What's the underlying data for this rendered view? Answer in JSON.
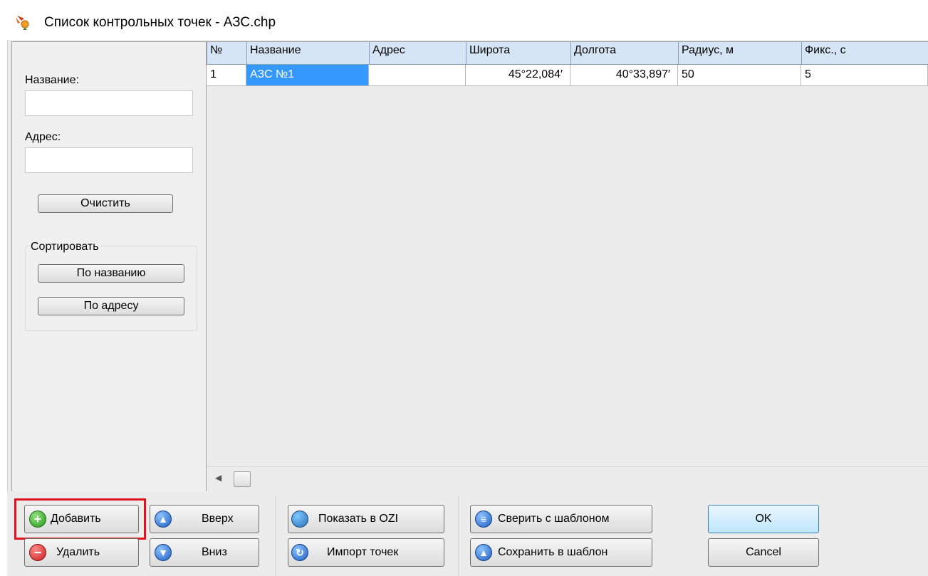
{
  "window": {
    "title": "Список контрольных точек - АЗС.chp",
    "icon": "satellite-pin-icon"
  },
  "filter": {
    "name_label": "Название:",
    "name_value": "",
    "address_label": "Адрес:",
    "address_value": "",
    "clear_label": "Очистить"
  },
  "sort": {
    "group_label": "Сортировать",
    "by_name_label": "По названию",
    "by_address_label": "По адресу"
  },
  "table": {
    "columns": [
      "№",
      "Название",
      "Адрес",
      "Широта",
      "Долгота",
      "Радиус, м",
      "Фикс., с"
    ],
    "rows": [
      [
        "1",
        "АЗС №1",
        "",
        "45°22,084′",
        "40°33,897′",
        "50",
        "5"
      ]
    ],
    "selected_row": 0,
    "selected_column": 1
  },
  "toolbar": {
    "add_label": "Добавить",
    "delete_label": "Удалить",
    "up_label": "Вверх",
    "down_label": "Вниз",
    "show_ozi_label": "Показать в OZI",
    "import_label": "Импорт точек",
    "compare_label": "Сверить с шаблоном",
    "save_template_label": "Сохранить в шаблон",
    "ok_label": "OK",
    "cancel_label": "Cancel"
  },
  "colors": {
    "selection": "#3399ff",
    "header": "#d6e5f5",
    "highlight": "#e0141e"
  }
}
